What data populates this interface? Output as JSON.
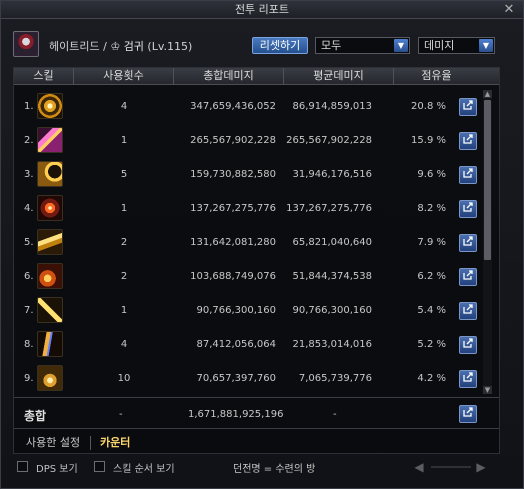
{
  "window": {
    "title": "전투 리포트",
    "close_glyph": "✕"
  },
  "header": {
    "character": "헤이트리드 / ",
    "class_icon": "♔",
    "class_name": "검귀",
    "level": " (Lv.115)",
    "reset_label": "리셋하기",
    "target_select": "모두",
    "type_select": "데미지"
  },
  "columns": {
    "skill": "스킬",
    "count": "사용횟수",
    "total": "총합데미지",
    "avg": "평균데미지",
    "share": "점유율"
  },
  "rows": [
    {
      "idx": "1.",
      "icon": "skill-icon-ring",
      "count": "4",
      "total": "347,659,436,052",
      "avg": "86,914,859,013",
      "share": "20.8 %"
    },
    {
      "idx": "2.",
      "icon": "skill-icon-slash-pink",
      "count": "1",
      "total": "265,567,902,228",
      "avg": "265,567,902,228",
      "share": "15.9 %"
    },
    {
      "idx": "3.",
      "icon": "skill-icon-crescent",
      "count": "5",
      "total": "159,730,882,580",
      "avg": "31,946,176,516",
      "share": "9.6 %"
    },
    {
      "idx": "4.",
      "icon": "skill-icon-burst",
      "count": "1",
      "total": "137,267,275,776",
      "avg": "137,267,275,776",
      "share": "8.2 %"
    },
    {
      "idx": "5.",
      "icon": "skill-icon-wave",
      "count": "2",
      "total": "131,642,081,280",
      "avg": "65,821,040,640",
      "share": "7.9 %"
    },
    {
      "idx": "6.",
      "icon": "skill-icon-fire",
      "count": "2",
      "total": "103,688,749,076",
      "avg": "51,844,374,538",
      "share": "6.2 %"
    },
    {
      "idx": "7.",
      "icon": "skill-icon-cross",
      "count": "1",
      "total": "90,766,300,160",
      "avg": "90,766,300,160",
      "share": "5.4 %"
    },
    {
      "idx": "8.",
      "icon": "skill-icon-dash",
      "count": "4",
      "total": "87,412,056,064",
      "avg": "21,853,014,016",
      "share": "5.2 %"
    },
    {
      "idx": "9.",
      "icon": "skill-icon-swirl",
      "count": "10",
      "total": "70,657,397,760",
      "avg": "7,065,739,776",
      "share": "4.2 %"
    }
  ],
  "totals": {
    "label": "총합",
    "count": "-",
    "total": "1,671,881,925,196",
    "avg": "-"
  },
  "tabs": {
    "settings": "사용한 설정",
    "counter": "카운터"
  },
  "footer": {
    "dps_label": "DPS 보기",
    "order_label": "스킬 순서 보기",
    "dungeon": "던전명 = 수련의 방",
    "prev_glyph": "◀",
    "next_glyph": "▶"
  },
  "icons": {
    "share": "share-icon",
    "scroll_up": "▲",
    "scroll_down": "▼",
    "select_arrow": "▼"
  },
  "colors": {
    "accent": "#2a5090",
    "tab_active": "#ffd76a"
  }
}
